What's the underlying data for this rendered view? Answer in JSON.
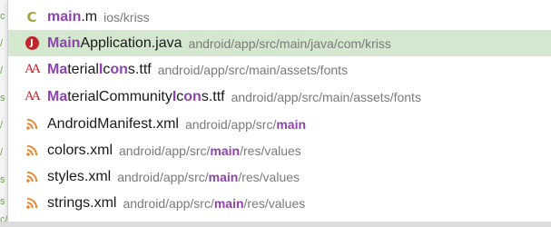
{
  "colors": {
    "selected_row": "#d4e8cf",
    "match_highlight": "#8e44ad",
    "path_text": "#7a7a7a",
    "java_icon": "#c0272d",
    "font_icon": "#c0272d",
    "xml_icon": "#e8842a",
    "c_icon": "#a5a341"
  },
  "editor_gutter": [
    "c",
    "/",
    "/",
    "s",
    "/",
    "/",
    "s",
    "s",
    "c/"
  ],
  "results": [
    {
      "icon": "c-file-icon",
      "icon_glyph": "C",
      "name_match": "main",
      "name_rest": ".m",
      "path_before": "ios/kriss",
      "path_match": "",
      "path_after": "",
      "selected": false
    },
    {
      "icon": "java-file-icon",
      "icon_glyph": "J",
      "name_match": "Main",
      "name_rest": "Application.java",
      "path_before": "android/app/src/main/java/com/kriss",
      "path_match": "",
      "path_after": "",
      "selected": true
    },
    {
      "icon": "font-file-icon",
      "icon_glyph": "AA",
      "name_parts": [
        {
          "text": "Ma",
          "match": true
        },
        {
          "text": "terial",
          "match": false
        },
        {
          "text": "I",
          "match": true
        },
        {
          "text": "c",
          "match": false
        },
        {
          "text": "on",
          "match": true
        },
        {
          "text": "s.ttf",
          "match": false
        }
      ],
      "path_before": "android/app/src/main/assets/fonts",
      "path_match": "",
      "path_after": "",
      "selected": false
    },
    {
      "icon": "font-file-icon",
      "icon_glyph": "AA",
      "name_parts": [
        {
          "text": "Ma",
          "match": true
        },
        {
          "text": "terialCommunity",
          "match": false
        },
        {
          "text": "I",
          "match": true
        },
        {
          "text": "c",
          "match": false
        },
        {
          "text": "on",
          "match": true
        },
        {
          "text": "s.ttf",
          "match": false
        }
      ],
      "path_before": "android/app/src/main/assets/fonts",
      "path_match": "",
      "path_after": "",
      "selected": false
    },
    {
      "icon": "xml-file-icon",
      "icon_glyph": "",
      "name_match": "",
      "name_rest": "AndroidManifest.xml",
      "path_before": "android/app/src/",
      "path_match": "main",
      "path_after": "",
      "selected": false
    },
    {
      "icon": "xml-file-icon",
      "icon_glyph": "",
      "name_match": "",
      "name_rest": "colors.xml",
      "path_before": "android/app/src/",
      "path_match": "main",
      "path_after": "/res/values",
      "selected": false
    },
    {
      "icon": "xml-file-icon",
      "icon_glyph": "",
      "name_match": "",
      "name_rest": "styles.xml",
      "path_before": "android/app/src/",
      "path_match": "main",
      "path_after": "/res/values",
      "selected": false
    },
    {
      "icon": "xml-file-icon",
      "icon_glyph": "",
      "name_match": "",
      "name_rest": "strings.xml",
      "path_before": "android/app/src/",
      "path_match": "main",
      "path_after": "/res/values",
      "selected": false
    }
  ]
}
